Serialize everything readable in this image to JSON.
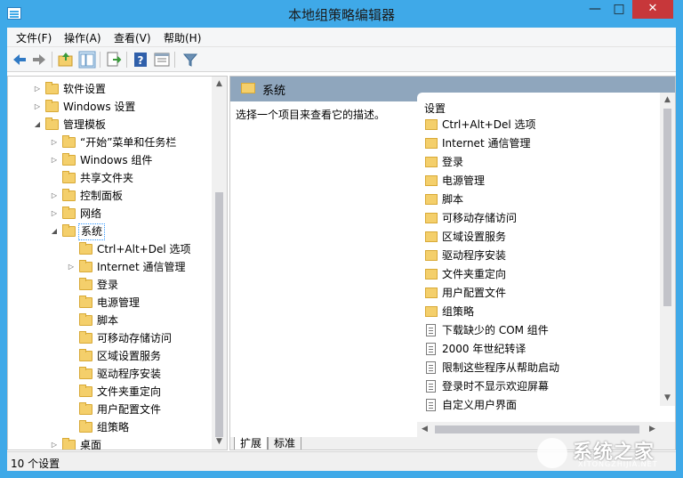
{
  "window": {
    "title": "本地组策略编辑器"
  },
  "menubar": {
    "items": [
      "文件(F)",
      "操作(A)",
      "查看(V)",
      "帮助(H)"
    ]
  },
  "toolbar": {
    "icons": [
      "back-arrow-icon",
      "forward-arrow-icon",
      "up-folder-icon",
      "show-hide-tree-icon",
      "export-list-icon",
      "help-icon",
      "properties-icon",
      "filter-icon"
    ]
  },
  "tree": {
    "items": [
      {
        "label": "软件设置",
        "expander": "▷"
      },
      {
        "label": "Windows 设置",
        "expander": "▷"
      },
      {
        "label": "管理模板",
        "expander": "◢"
      },
      {
        "label": "“开始”菜单和任务栏",
        "expander": "▷"
      },
      {
        "label": "Windows 组件",
        "expander": "▷"
      },
      {
        "label": "共享文件夹",
        "expander": ""
      },
      {
        "label": "控制面板",
        "expander": "▷"
      },
      {
        "label": "网络",
        "expander": "▷"
      },
      {
        "label": "系统",
        "expander": "◢"
      },
      {
        "label": "Ctrl+Alt+Del 选项",
        "expander": ""
      },
      {
        "label": "Internet 通信管理",
        "expander": "▷"
      },
      {
        "label": "登录",
        "expander": ""
      },
      {
        "label": "电源管理",
        "expander": ""
      },
      {
        "label": "脚本",
        "expander": ""
      },
      {
        "label": "可移动存储访问",
        "expander": ""
      },
      {
        "label": "区域设置服务",
        "expander": ""
      },
      {
        "label": "驱动程序安装",
        "expander": ""
      },
      {
        "label": "文件夹重定向",
        "expander": ""
      },
      {
        "label": "用户配置文件",
        "expander": ""
      },
      {
        "label": "组策略",
        "expander": ""
      },
      {
        "label": "桌面",
        "expander": "▷"
      }
    ]
  },
  "right": {
    "header_title": "系统",
    "description": "选择一个项目来查看它的描述。",
    "column_header": "设置",
    "items": [
      {
        "label": "Ctrl+Alt+Del 选项",
        "kind": "folder"
      },
      {
        "label": "Internet 通信管理",
        "kind": "folder"
      },
      {
        "label": "登录",
        "kind": "folder"
      },
      {
        "label": "电源管理",
        "kind": "folder"
      },
      {
        "label": "脚本",
        "kind": "folder"
      },
      {
        "label": "可移动存储访问",
        "kind": "folder"
      },
      {
        "label": "区域设置服务",
        "kind": "folder"
      },
      {
        "label": "驱动程序安装",
        "kind": "folder"
      },
      {
        "label": "文件夹重定向",
        "kind": "folder"
      },
      {
        "label": "用户配置文件",
        "kind": "folder"
      },
      {
        "label": "组策略",
        "kind": "folder"
      },
      {
        "label": "下载缺少的 COM 组件",
        "kind": "setting"
      },
      {
        "label": "2000 年世纪转译",
        "kind": "setting"
      },
      {
        "label": "限制这些程序从帮助启动",
        "kind": "setting"
      },
      {
        "label": "登录时不显示欢迎屏幕",
        "kind": "setting"
      },
      {
        "label": "自定义用户界面",
        "kind": "setting"
      }
    ],
    "tabs": [
      "扩展",
      "标准"
    ]
  },
  "statusbar": {
    "text": "10 个设置"
  },
  "watermark": {
    "text": "系统之家",
    "sub": "XITONGZHIJIA.NET"
  },
  "colors": {
    "title_bg": "#3fa9e8",
    "close_btn": "#c7373a",
    "pane_header": "#8fa6bd",
    "folder": "#f4cf6b"
  }
}
